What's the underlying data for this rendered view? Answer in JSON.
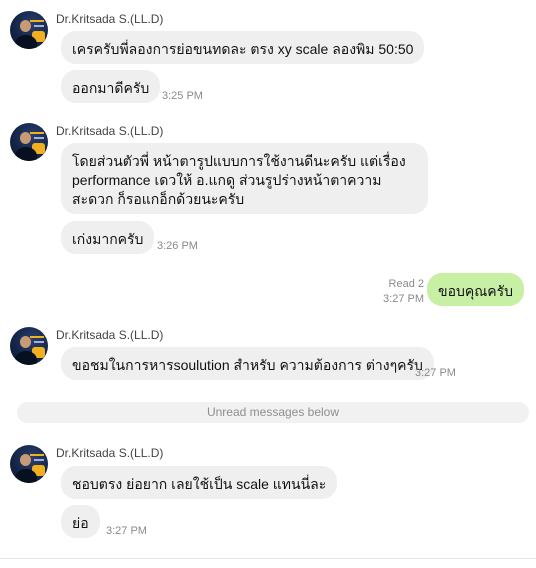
{
  "sender_name": "Dr.Kritsada S.(LL.D)",
  "messages": [
    {
      "text": "เครครับพี่ลองการย่อขนทดละ ตรง xy scale ลองพิม 50:50"
    },
    {
      "text": "ออกมาดีครับ",
      "time": "3:25 PM"
    },
    {
      "text": "โดยส่วนตัวพี่ หน้าตารูปแบบการใช้งานดีนะครับ แต่เรื่อง performance เดวให้ อ.แกดู  ส่วนรูปร่างหน้าตาความสะดวก ก็รอแกอ็กด้วยนะครับ"
    },
    {
      "text": "เก่งมากครับ",
      "time": "3:26 PM"
    },
    {
      "text": "ขอบคุณครับ",
      "time": "3:27 PM",
      "status": "Read 2"
    },
    {
      "text": "ขอชมในการหารsoulution สำหรับ ความต้องการ ต่างๆครับ",
      "time": "3:27 PM"
    },
    {
      "text": "ชอบตรง ย่อยาก เลยใช้เป็น scale แทนนี่ละ"
    },
    {
      "text": "ย่อ",
      "time": "3:27 PM"
    }
  ],
  "divider": {
    "label": "Unread messages below"
  }
}
